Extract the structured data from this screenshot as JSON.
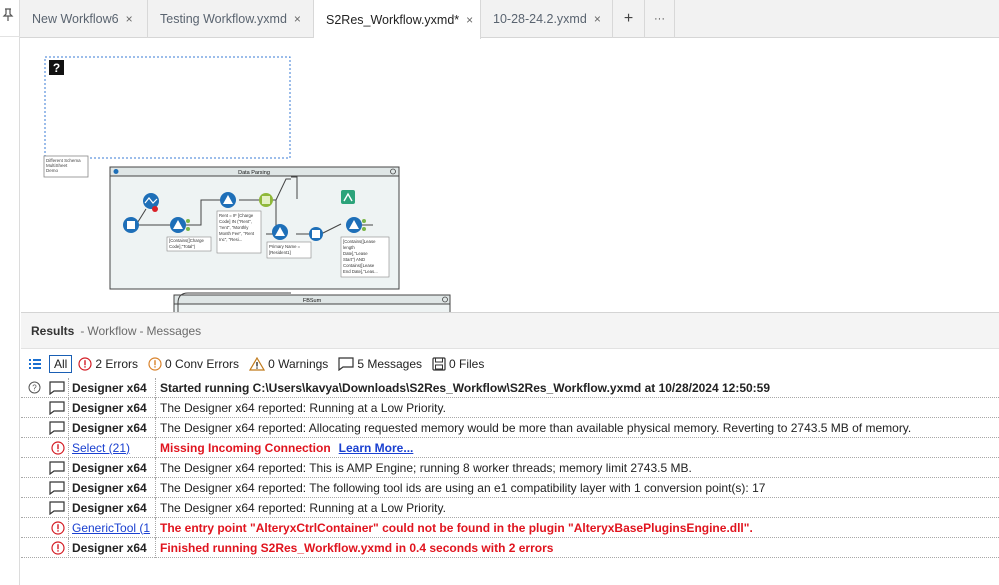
{
  "tabs": [
    {
      "label": "New Workflow6",
      "close": "×"
    },
    {
      "label": "Testing Workflow.yxmd",
      "close": "×"
    },
    {
      "label": "S2Res_Workflow.yxmd*",
      "close": "×"
    },
    {
      "label": "10-28-24.2.yxmd",
      "close": "×"
    }
  ],
  "tab_actions": {
    "add": "+",
    "more": "···"
  },
  "canvas": {
    "comment_text": "Different Schema MultiSheet Demo",
    "container1_title": "Data Parsing",
    "container2_title": "FBSum",
    "annot_filter1": "[Contains([Charge Code],\"Total\")",
    "annot_formula": "Rent = IF [Charge Code] IN (\"Rent\", \"rent\", \"Monthly Month Fee\", \"Rent Inc\", \"Resi...",
    "annot_primary": "Primary Name = [Resident1]",
    "annot_filter2": "[Contains([Lease length Date],\"Lease Start\") AND Contains([Lease End Date],\"Leas..."
  },
  "results": {
    "title": "Results",
    "crumb1": "Workflow",
    "crumb2": "Messages",
    "sep": "-"
  },
  "filters": {
    "all": "All",
    "errors": "2 Errors",
    "conv_errors": "0 Conv Errors",
    "warnings": "0 Warnings",
    "messages": "5 Messages",
    "files": "0 Files"
  },
  "messages": [
    {
      "type": "message",
      "source": "Designer x64",
      "text": "Started running C:\\Users\\kavya\\Downloads\\S2Res_Workflow\\S2Res_Workflow.yxmd at 10/28/2024 12:50:59",
      "style": "bold"
    },
    {
      "type": "message",
      "source": "Designer x64",
      "text": "The Designer x64 reported: Running at a Low Priority.",
      "style": "normal"
    },
    {
      "type": "message",
      "source": "Designer x64",
      "text": "The Designer x64 reported: Allocating requested memory would be more than available physical memory. Reverting to 2743.5 MB of memory.",
      "style": "normal"
    },
    {
      "type": "error",
      "source": "Select (21)",
      "text": "Missing Incoming Connection",
      "style": "err",
      "link": "Learn More..."
    },
    {
      "type": "message",
      "source": "Designer x64",
      "text": "The Designer x64 reported: This is AMP Engine; running 8 worker threads; memory limit 2743.5 MB.",
      "style": "normal"
    },
    {
      "type": "message",
      "source": "Designer x64",
      "text": "The Designer x64 reported: The following tool ids are using an e1 compatibility layer with 1 conversion point(s): 17",
      "style": "normal"
    },
    {
      "type": "message",
      "source": "Designer x64",
      "text": "The Designer x64 reported: Running at a Low Priority.",
      "style": "normal"
    },
    {
      "type": "error",
      "source": "GenericTool (1",
      "text": "The entry point \"AlteryxCtrlContainer\" could not be found in the plugin \"AlteryxBasePluginsEngine.dll\".",
      "style": "err"
    },
    {
      "type": "error",
      "source": "Designer x64",
      "text": "Finished running S2Res_Workflow.yxmd in 0.4 seconds with 2 errors",
      "style": "err"
    }
  ],
  "colors": {
    "accent": "#1a5fb4",
    "error": "#e0141e",
    "tool_blue": "#1e6fb8",
    "tool_green": "#7ab648"
  }
}
